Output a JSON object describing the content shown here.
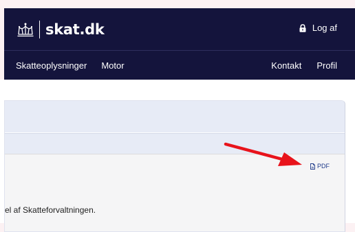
{
  "header": {
    "logo_text": "skat.dk",
    "logout_label": "Log af",
    "nav_left": [
      "Skatteoplysninger",
      "Motor"
    ],
    "nav_right": [
      "Kontakt",
      "Profil"
    ]
  },
  "card": {
    "pdf_label": "PDF",
    "body_text": "el af Skatteforvaltningen."
  },
  "colors": {
    "header_bg": "#14143c",
    "card_head_bg": "#e7ebf6",
    "arrow": "#e8131b",
    "link": "#1f3b8a"
  },
  "icons": {
    "logo": "crown-icon",
    "logout": "lock-icon",
    "pdf": "document-icon",
    "annotation": "red-arrow"
  }
}
